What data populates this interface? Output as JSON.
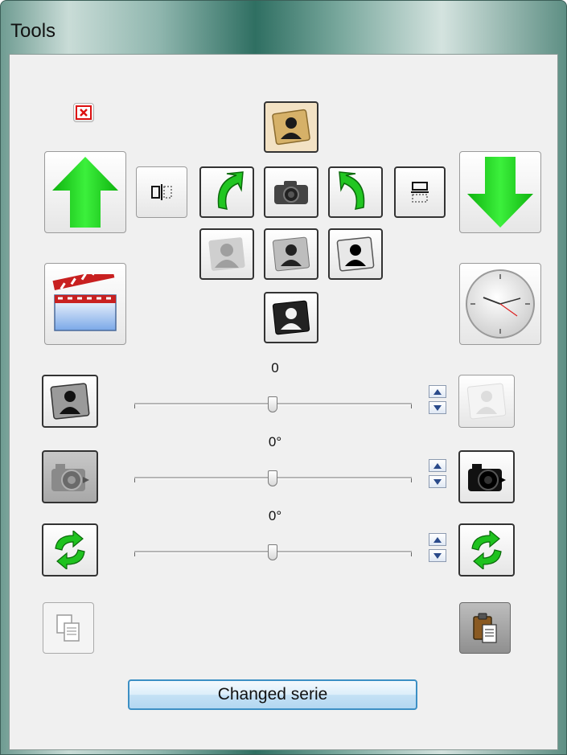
{
  "window": {
    "title": "Tools"
  },
  "sliders": [
    {
      "id": "opacity",
      "value_text": "0"
    },
    {
      "id": "contrast",
      "value_text": "0°"
    },
    {
      "id": "rotate",
      "value_text": "0°"
    }
  ],
  "buttons": {
    "changed_serie": "Changed serie"
  },
  "icons": {
    "close": "close-icon",
    "move_up": "arrow-up-icon",
    "move_down": "arrow-down-icon",
    "clapper": "clapperboard-icon",
    "clock": "clock-icon",
    "copy": "copy-icon",
    "paste": "clipboard-icon"
  },
  "colors": {
    "accent": "#3c8fc4",
    "arrow": "#22e022"
  }
}
